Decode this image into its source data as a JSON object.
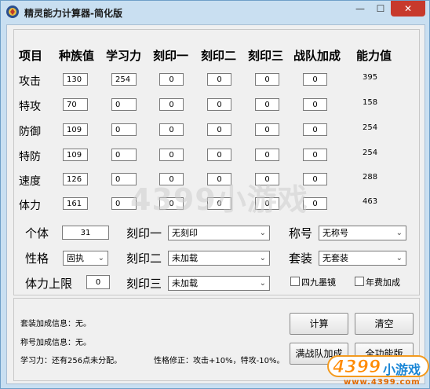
{
  "window": {
    "title": "精灵能力计算器-简化版",
    "minimize_glyph": "—",
    "maximize_glyph": "☐",
    "close_glyph": "✕"
  },
  "table": {
    "headers": [
      "项目",
      "种族值",
      "学习力",
      "刻印一",
      "刻印二",
      "刻印三",
      "战队加成",
      "能力值"
    ],
    "rows": [
      {
        "label": "攻击",
        "race": "130",
        "learn": "254",
        "seal1": "0",
        "seal2": "0",
        "seal3": "0",
        "team": "0",
        "value": "395"
      },
      {
        "label": "特攻",
        "race": "70",
        "learn": "0",
        "seal1": "0",
        "seal2": "0",
        "seal3": "0",
        "team": "0",
        "value": "158"
      },
      {
        "label": "防御",
        "race": "109",
        "learn": "0",
        "seal1": "0",
        "seal2": "0",
        "seal3": "0",
        "team": "0",
        "value": "254"
      },
      {
        "label": "特防",
        "race": "109",
        "learn": "0",
        "seal1": "0",
        "seal2": "0",
        "seal3": "0",
        "team": "0",
        "value": "254"
      },
      {
        "label": "速度",
        "race": "126",
        "learn": "0",
        "seal1": "0",
        "seal2": "0",
        "seal3": "0",
        "team": "0",
        "value": "288"
      },
      {
        "label": "体力",
        "race": "161",
        "learn": "0",
        "seal1": "0",
        "seal2": "0",
        "seal3": "0",
        "team": "0",
        "value": "463"
      }
    ]
  },
  "settings": {
    "individual_label": "个体",
    "individual_value": "31",
    "nature_label": "性格",
    "nature_value": "固执",
    "hp_limit_label": "体力上限",
    "hp_limit_value": "0",
    "seal1_label": "刻印一",
    "seal1_value": "无刻印",
    "seal2_label": "刻印二",
    "seal2_value": "未加载",
    "seal3_label": "刻印三",
    "seal3_value": "未加载",
    "title_label": "称号",
    "title_value": "无称号",
    "suit_label": "套装",
    "suit_value": "无套装",
    "checkbox1_label": "四九墨镜",
    "checkbox2_label": "年费加成"
  },
  "info": {
    "suit_info": "套装加成信息：无。",
    "title_info": "称号加成信息：无。",
    "learn_info": "学习力：还有256点未分配。",
    "nature_info": "性格修正：攻击+10%，特攻-10%。"
  },
  "buttons": {
    "calc": "计算",
    "clear": "清空",
    "full_team": "满战队加成",
    "full_version": "全功能版"
  },
  "watermark": {
    "text": "4399小游戏",
    "logo_text": "4399",
    "logo_sub": "小游戏",
    "logo_url": "www.4399.com"
  }
}
